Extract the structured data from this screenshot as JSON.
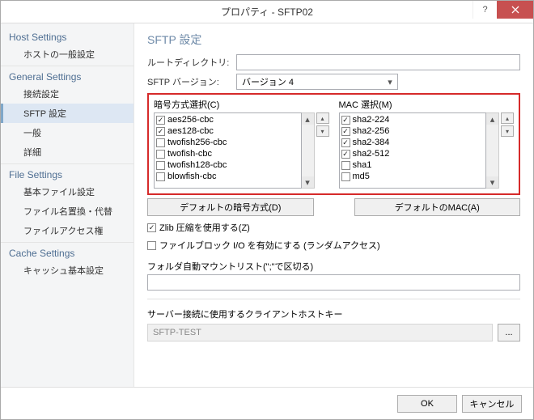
{
  "window": {
    "title": "プロパティ - SFTP02"
  },
  "sidebar": {
    "groups": [
      {
        "head": "Host Settings",
        "items": [
          "ホストの一般設定"
        ]
      },
      {
        "head": "General Settings",
        "items": [
          "接続設定",
          "SFTP 設定",
          "一般",
          "詳細"
        ]
      },
      {
        "head": "File Settings",
        "items": [
          "基本ファイル設定",
          "ファイル名置換・代替",
          "ファイルアクセス権"
        ]
      },
      {
        "head": "Cache Settings",
        "items": [
          "キャッシュ基本設定"
        ]
      }
    ],
    "active": "SFTP 設定"
  },
  "main": {
    "heading": "SFTP 設定",
    "root_dir_label": "ルートディレクトリ:",
    "root_dir_value": "",
    "version_label": "SFTP バージョン:",
    "version_value": "バージョン 4",
    "cipher_label": "暗号方式選択(C)",
    "mac_label": "MAC 選択(M)",
    "ciphers": [
      {
        "label": "aes256-cbc",
        "checked": true
      },
      {
        "label": "aes128-cbc",
        "checked": true
      },
      {
        "label": "twofish256-cbc",
        "checked": false
      },
      {
        "label": "twofish-cbc",
        "checked": false
      },
      {
        "label": "twofish128-cbc",
        "checked": false
      },
      {
        "label": "blowfish-cbc",
        "checked": false
      }
    ],
    "macs": [
      {
        "label": "sha2-224",
        "checked": true
      },
      {
        "label": "sha2-256",
        "checked": true
      },
      {
        "label": "sha2-384",
        "checked": true
      },
      {
        "label": "sha2-512",
        "checked": true
      },
      {
        "label": "sha1",
        "checked": false
      },
      {
        "label": "md5",
        "checked": false
      }
    ],
    "default_cipher_btn": "デフォルトの暗号方式(D)",
    "default_mac_btn": "デフォルトのMAC(A)",
    "zlib_label": "Zlib 圧縮を使用する(Z)",
    "zlib_checked": true,
    "fileblock_label": "ファイルブロック I/O を有効にする (ランダムアクセス)",
    "fileblock_checked": false,
    "automount_label": "フォルダ自動マウントリスト(\";\"で区切る)",
    "automount_value": "",
    "hostkey_label": "サーバー接続に使用するクライアントホストキー",
    "hostkey_value": "SFTP-TEST",
    "browse": "..."
  },
  "footer": {
    "ok": "OK",
    "cancel": "キャンセル"
  }
}
